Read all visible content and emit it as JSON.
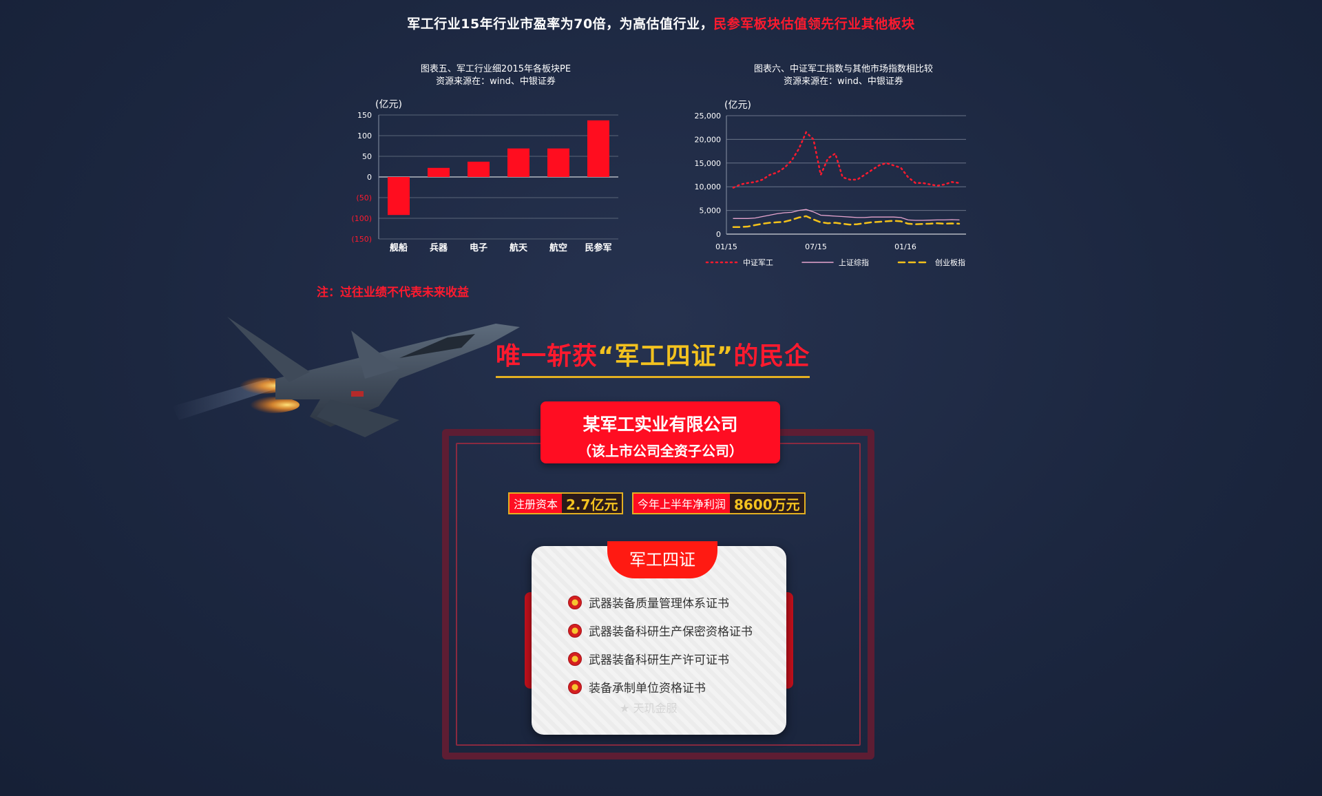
{
  "headline": {
    "main": "军工行业15年行业市盈率为70倍，为高估值行业，",
    "highlight": "民参军板块估值领先行业其他板块"
  },
  "chart_data": [
    {
      "type": "bar",
      "title": "图表五、军工行业细2015年各板块PE",
      "subtitle": "资源来源在：wind、中银证券",
      "ylabel": "(亿元)",
      "categories": [
        "舰船",
        "兵器",
        "电子",
        "航天",
        "航空",
        "民参军"
      ],
      "values": [
        -92,
        22,
        37,
        69,
        69,
        137
      ],
      "ylim": [
        -150,
        150
      ],
      "yticks": [
        150,
        100,
        50,
        0,
        -50,
        -100,
        -150
      ],
      "ytick_labels": [
        "150",
        "100",
        "50",
        "0",
        "(50)",
        "(100)",
        "(150)"
      ],
      "bar_color": "#ff0d1f"
    },
    {
      "type": "line",
      "title": "图表六、中证军工指数与其他市场指数相比较",
      "subtitle": "资源来源在：wind、中银证券",
      "ylabel": "(亿元)",
      "ylim": [
        0,
        25000
      ],
      "yticks": [
        0,
        5000,
        10000,
        15000,
        20000,
        25000
      ],
      "ytick_labels": [
        "0",
        "5,000",
        "10,000",
        "15,000",
        "20,000",
        "25,000"
      ],
      "xtick_labels": [
        "01/15",
        "07/15",
        "01/16"
      ],
      "series": [
        {
          "name": "中证军工",
          "color": "#ff1a2e",
          "style": "dotted",
          "values": [
            9800,
            10500,
            10800,
            11000,
            11500,
            12500,
            13000,
            14000,
            15500,
            18000,
            21500,
            20000,
            12500,
            16000,
            17000,
            12000,
            11500,
            11500,
            12500,
            13500,
            14500,
            15000,
            14500,
            14000,
            12000,
            10800,
            10800,
            10500,
            10200,
            10500,
            11000,
            10800
          ]
        },
        {
          "name": "上证综指",
          "color": "#e8a6cf",
          "style": "solid",
          "values": [
            3300,
            3300,
            3300,
            3400,
            3700,
            4000,
            4300,
            4500,
            4600,
            5000,
            5200,
            4700,
            4000,
            3900,
            3800,
            3700,
            3600,
            3500,
            3500,
            3600,
            3600,
            3600,
            3600,
            3500,
            3000,
            2900,
            2900,
            2950,
            3000,
            3000,
            3050,
            3000
          ]
        },
        {
          "name": "创业板指",
          "color": "#f4c21a",
          "style": "dashed",
          "values": [
            1500,
            1500,
            1600,
            1900,
            2200,
            2400,
            2500,
            2600,
            3000,
            3500,
            3800,
            3100,
            2500,
            2300,
            2400,
            2200,
            2000,
            2100,
            2300,
            2500,
            2600,
            2700,
            2800,
            2700,
            2200,
            2100,
            2150,
            2200,
            2300,
            2200,
            2250,
            2200
          ]
        }
      ]
    }
  ],
  "note": "注：过往业绩不代表未来收益",
  "slogan": {
    "pre": "唯一斩获",
    "quote": "“军工四证”",
    "post": "的民企"
  },
  "company": {
    "name": "某军工实业有限公司",
    "sub": "（该上市公司全资子公司）"
  },
  "tags": [
    {
      "label": "注册资本",
      "value": "2.7亿元"
    },
    {
      "label": "今年上半年净利润",
      "value": "8600万元"
    }
  ],
  "certificates": {
    "title": "军工四证",
    "items": [
      "武器装备质量管理体系证书",
      "武器装备科研生产保密资格证书",
      "武器装备科研生产许可证书",
      "装备承制单位资格证书"
    ],
    "watermark": "天玑金服"
  }
}
